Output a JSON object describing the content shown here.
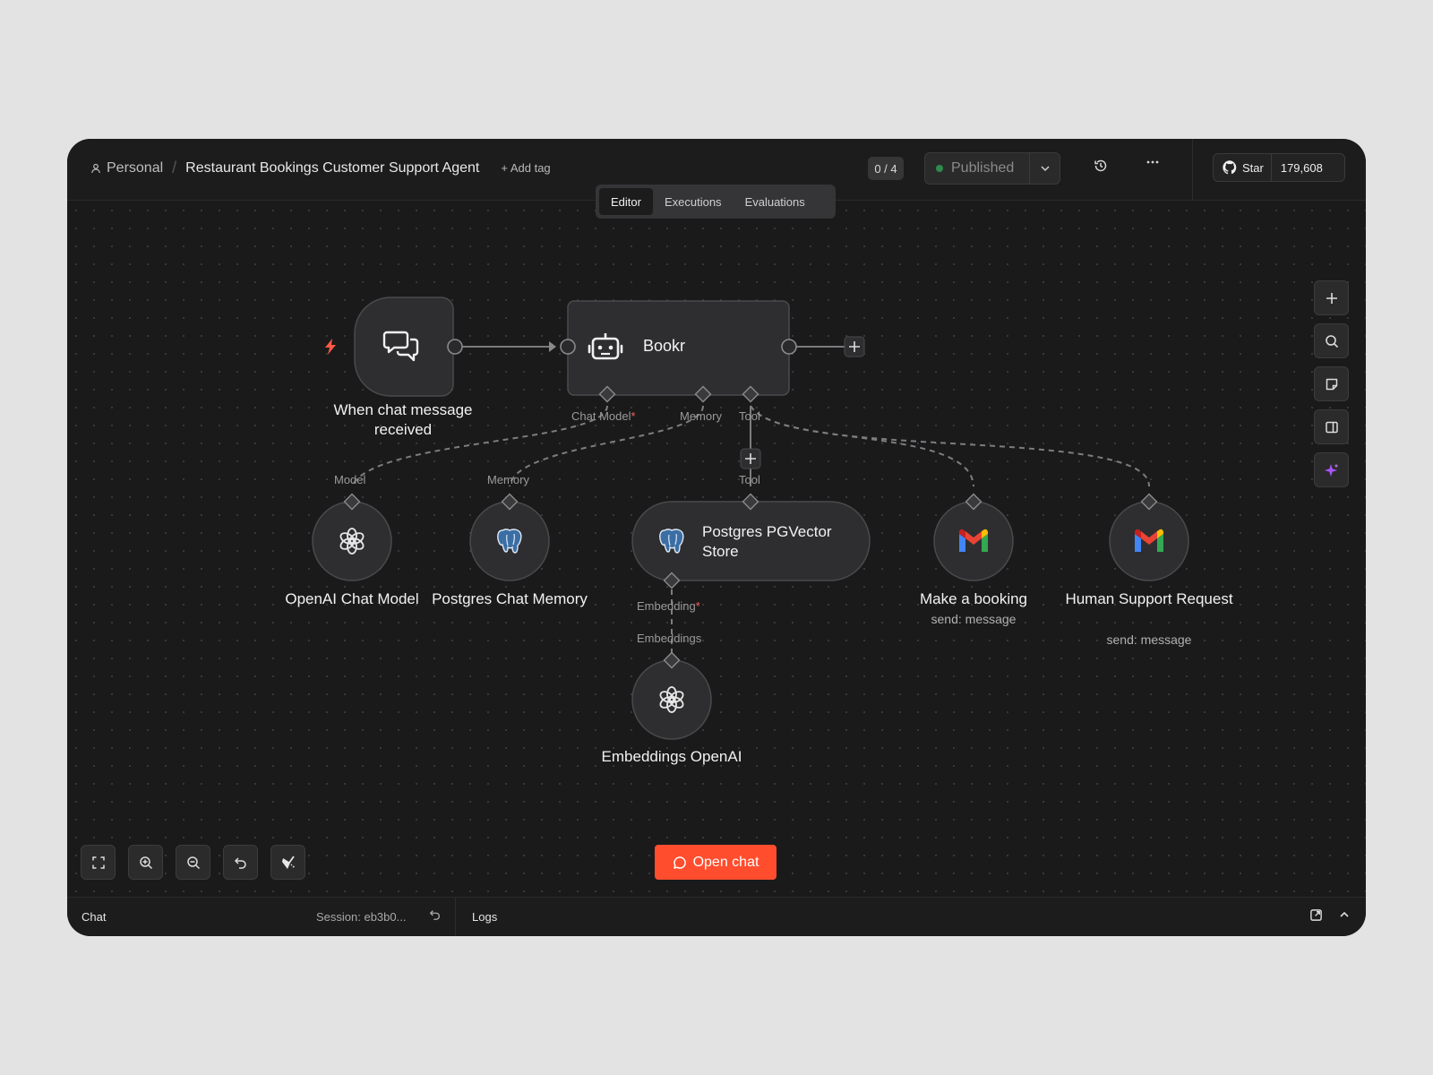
{
  "header": {
    "breadcrumb_root": "Personal",
    "workflow_title": "Restaurant Bookings Customer Support Agent",
    "add_tag": "+ Add tag",
    "counter": "0 / 4",
    "publish_status": "Published",
    "github_star": "Star",
    "github_count": "179,608"
  },
  "tabs": [
    {
      "label": "Editor",
      "active": true
    },
    {
      "label": "Executions",
      "active": false
    },
    {
      "label": "Evaluations",
      "active": false
    }
  ],
  "nodes": {
    "trigger": {
      "label": "When chat message received",
      "icon": "chat-bubbles-icon"
    },
    "agent": {
      "label": "Bookr",
      "icon": "robot-icon"
    },
    "chat_model": {
      "label": "OpenAI Chat Model",
      "icon": "openai-icon"
    },
    "memory": {
      "label": "Postgres Chat Memory",
      "icon": "postgres-icon"
    },
    "vector_store": {
      "label": "Postgres PGVector Store",
      "icon": "postgres-icon"
    },
    "booking": {
      "label": "Make a booking",
      "sub": "send: message",
      "icon": "gmail-icon"
    },
    "human": {
      "label": "Human Support Request",
      "sub": "send: message",
      "icon": "gmail-icon"
    },
    "embeddings": {
      "label": "Embeddings OpenAI",
      "icon": "openai-icon"
    }
  },
  "ports": {
    "agent_chat_model": "Chat Model",
    "agent_memory": "Memory",
    "agent_tool": "Tool",
    "model_in": "Model",
    "memory_in": "Memory",
    "tool_in": "Tool",
    "embedding_out": "Embedding",
    "embeddings_in": "Embeddings",
    "required_mark": "*"
  },
  "canvas": {
    "open_chat": "Open chat"
  },
  "footer": {
    "chat": "Chat",
    "session": "Session: eb3b0...",
    "logs": "Logs"
  },
  "colors": {
    "accent": "#ff4d2e",
    "published_dot": "#2e8b4c",
    "trigger_bolt": "#ff5a44",
    "ai_sparkle": "#a855f7"
  }
}
